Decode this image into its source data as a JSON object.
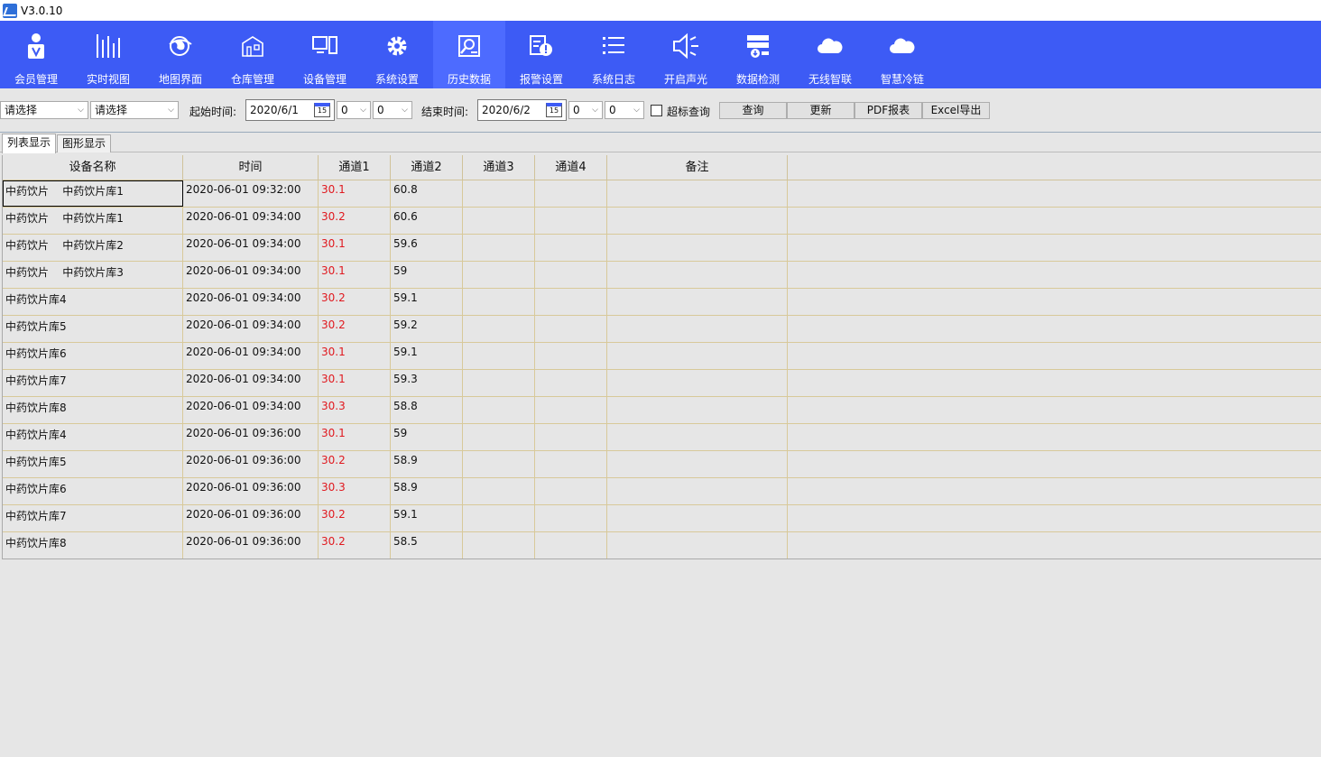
{
  "window": {
    "title": "V3.0.10"
  },
  "toolbar": {
    "items": [
      {
        "label": "会员管理",
        "icon": "user-badge-icon"
      },
      {
        "label": "实时视图",
        "icon": "bar-chart-icon"
      },
      {
        "label": "地图界面",
        "icon": "globe-icon"
      },
      {
        "label": "仓库管理",
        "icon": "warehouse-icon"
      },
      {
        "label": "设备管理",
        "icon": "device-icon"
      },
      {
        "label": "系统设置",
        "icon": "gear-icon"
      },
      {
        "label": "历史数据",
        "icon": "history-search-icon"
      },
      {
        "label": "报警设置",
        "icon": "alarm-icon"
      },
      {
        "label": "系统日志",
        "icon": "list-icon"
      },
      {
        "label": "开启声光",
        "icon": "speaker-icon"
      },
      {
        "label": "数据检测",
        "icon": "database-icon"
      },
      {
        "label": "无线智联",
        "icon": "cloud-icon"
      },
      {
        "label": "智慧冷链",
        "icon": "cloud-icon"
      }
    ],
    "active_index": 6
  },
  "filters": {
    "select1": "请选择",
    "select2": "请选择",
    "start_label": "起始时间:",
    "start_date": "2020/6/1",
    "start_hour": "0",
    "start_min": "0",
    "end_label": "结束时间:",
    "end_date": "2020/6/2",
    "end_hour": "0",
    "end_min": "0",
    "cal_day": "15",
    "exceed_label": "超标查询",
    "query": "查询",
    "refresh": "更新",
    "pdf": "PDF报表",
    "excel": "Excel导出"
  },
  "tabs": [
    "列表显示",
    "图形显示"
  ],
  "table": {
    "columns": [
      "设备名称",
      "时间",
      "通道1",
      "通道2",
      "通道3",
      "通道4",
      "备注",
      ""
    ],
    "rows": [
      [
        "中药饮片    中药饮片库1",
        "2020-06-01 09:32:00",
        "30.1",
        "60.8",
        "",
        "",
        "",
        ""
      ],
      [
        "中药饮片    中药饮片库1",
        "2020-06-01 09:34:00",
        "30.2",
        "60.6",
        "",
        "",
        "",
        ""
      ],
      [
        "中药饮片    中药饮片库2",
        "2020-06-01 09:34:00",
        "30.1",
        "59.6",
        "",
        "",
        "",
        ""
      ],
      [
        "中药饮片    中药饮片库3",
        "2020-06-01 09:34:00",
        "30.1",
        "59",
        "",
        "",
        "",
        ""
      ],
      [
        "中药饮片库4",
        "2020-06-01 09:34:00",
        "30.2",
        "59.1",
        "",
        "",
        "",
        ""
      ],
      [
        "中药饮片库5",
        "2020-06-01 09:34:00",
        "30.2",
        "59.2",
        "",
        "",
        "",
        ""
      ],
      [
        "中药饮片库6",
        "2020-06-01 09:34:00",
        "30.1",
        "59.1",
        "",
        "",
        "",
        ""
      ],
      [
        "中药饮片库7",
        "2020-06-01 09:34:00",
        "30.1",
        "59.3",
        "",
        "",
        "",
        ""
      ],
      [
        "中药饮片库8",
        "2020-06-01 09:34:00",
        "30.3",
        "58.8",
        "",
        "",
        "",
        ""
      ],
      [
        "中药饮片库4",
        "2020-06-01 09:36:00",
        "30.1",
        "59",
        "",
        "",
        "",
        ""
      ],
      [
        "中药饮片库5",
        "2020-06-01 09:36:00",
        "30.2",
        "58.9",
        "",
        "",
        "",
        ""
      ],
      [
        "中药饮片库6",
        "2020-06-01 09:36:00",
        "30.3",
        "58.9",
        "",
        "",
        "",
        ""
      ],
      [
        "中药饮片库7",
        "2020-06-01 09:36:00",
        "30.2",
        "59.1",
        "",
        "",
        "",
        ""
      ],
      [
        "中药饮片库8",
        "2020-06-01 09:36:00",
        "30.2",
        "58.5",
        "",
        "",
        "",
        ""
      ]
    ]
  },
  "colors": {
    "toolbar": "#3d5bf5",
    "alarm_text": "#e0191f",
    "grid_line": "#d8c99a"
  }
}
